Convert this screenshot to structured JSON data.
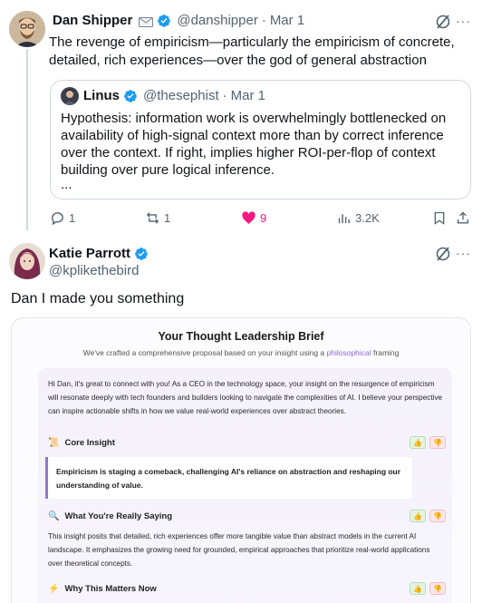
{
  "tweet1": {
    "author_name": "Dan Shipper",
    "author_handle": "@danshipper",
    "date": "Mar 1",
    "text": "The revenge of empiricism—particularly the empiricism of concrete, detailed, rich experiences—over the god of general abstraction",
    "quote": {
      "author_name": "Linus",
      "author_handle": "@thesephist",
      "date": "Mar 1",
      "text": "Hypothesis: information work is overwhelmingly bottlenecked on availability of high-signal context more than by correct inference over the context. If right, implies higher ROI-per-flop of context building over pure logical inference.",
      "ellipsis": "..."
    },
    "actions": {
      "replies": "1",
      "reposts": "1",
      "likes": "9",
      "views": "3.2K"
    }
  },
  "tweet2": {
    "author_name": "Katie Parrott",
    "author_handle": "@kplikethebird",
    "text": "Dan I made you something"
  },
  "embed": {
    "title": "Your Thought Leadership Brief",
    "subtitle_pre": "We've crafted a comprehensive proposal based on your insight using a ",
    "subtitle_hl": "philosophical",
    "subtitle_post": " framing",
    "intro": "Hi Dan, it's great to connect with you! As a CEO in the technology space, your insight on the resurgence of empiricism will resonate deeply with tech founders and builders looking to navigate the complexities of AI. I believe your perspective can inspire actionable shifts in how we value real-world experiences over abstract theories.",
    "sections": [
      {
        "icon": "scroll-icon",
        "title": "Core Insight",
        "quote": "Empiricism is staging a comeback, challenging AI's reliance on abstraction and reshaping our understanding of value."
      },
      {
        "icon": "magnifier-icon",
        "title": "What You're Really Saying",
        "body": "This insight posits that detailed, rich experiences offer more tangible value than abstract models in the current AI landscape. It emphasizes the growing need for grounded, empirical approaches that prioritize real-world applications over theoretical concepts."
      },
      {
        "icon": "lightning-icon",
        "title": "Why This Matters Now"
      }
    ]
  },
  "colors": {
    "accent": "#1d9bf0",
    "like": "#f91880",
    "muted": "#536471",
    "border": "#cfd9de"
  }
}
